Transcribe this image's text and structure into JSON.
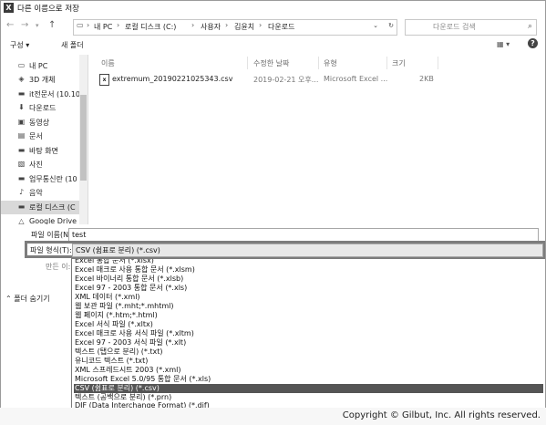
{
  "window": {
    "title": "다른 이름으로 저장",
    "title_icon": "X"
  },
  "address_bar": {
    "breadcrumbs": [
      "내 PC",
      "로컬 디스크 (C:)",
      "사용자",
      "김윤치",
      "다운로드"
    ],
    "search_placeholder": "다운로드 검색"
  },
  "toolbar": {
    "organize": "구성 ▾",
    "new_folder": "새 폴더"
  },
  "sidebar": {
    "items": [
      {
        "label": "내 PC",
        "icon": "pc-icon"
      },
      {
        "label": "3D 개체",
        "icon": "cube-icon"
      },
      {
        "label": "it전문서 (10.10",
        "icon": "network-drive-icon"
      },
      {
        "label": "다운로드",
        "icon": "download-icon"
      },
      {
        "label": "동영상",
        "icon": "video-icon"
      },
      {
        "label": "문서",
        "icon": "document-icon"
      },
      {
        "label": "바탕 화면",
        "icon": "desktop-icon"
      },
      {
        "label": "사진",
        "icon": "pictures-icon"
      },
      {
        "label": "업무통신란 (10",
        "icon": "network-drive-icon"
      },
      {
        "label": "음악",
        "icon": "music-icon"
      },
      {
        "label": "로컬 디스크 (C",
        "icon": "disk-icon"
      },
      {
        "label": "Google Drive (",
        "icon": "drive-icon"
      }
    ],
    "selected_index": 10
  },
  "file_list": {
    "columns": [
      "이름",
      "수정한 날짜",
      "유형",
      "크기"
    ],
    "rows": [
      {
        "name": "extremum_20190221025343.csv",
        "date": "2019-02-21 오후...",
        "type": "Microsoft Excel ...",
        "size": "2KB"
      }
    ]
  },
  "form": {
    "filename_label": "파일 이름(N):",
    "filename_value": "test",
    "filetype_label": "파일 형식(T):",
    "filetype_value": "CSV (쉼표로 분리) (*.csv)",
    "author_label": "만든 이:",
    "hide_folders": "폴더 숨기기"
  },
  "filetype_options": [
    "Excel 통합 문서 (*.xlsx)",
    "Excel 매크로 사용 통합 문서 (*.xlsm)",
    "Excel 바이너리 통합 문서 (*.xlsb)",
    "Excel 97 - 2003 통합 문서 (*.xls)",
    "XML 데이터 (*.xml)",
    "웹 보관 파일 (*.mht;*.mhtml)",
    "웹 페이지 (*.htm;*.html)",
    "Excel 서식 파일 (*.xltx)",
    "Excel 매크로 사용 서식 파일 (*.xltm)",
    "Excel 97 - 2003 서식 파일 (*.xlt)",
    "텍스트 (탭으로 분리) (*.txt)",
    "유니코드 텍스트 (*.txt)",
    "XML 스프레드시트 2003 (*.xml)",
    "Microsoft Excel 5.0/95 통합 문서 (*.xls)",
    "CSV (쉼표로 분리) (*.csv)",
    "텍스트 (공백으로 분리) (*.prn)",
    "DIF (Data Interchange Format) (*.dif)"
  ],
  "selected_option_index": 14,
  "footer": {
    "copyright": "Copyright © Gilbut, Inc. All rights reserved."
  }
}
